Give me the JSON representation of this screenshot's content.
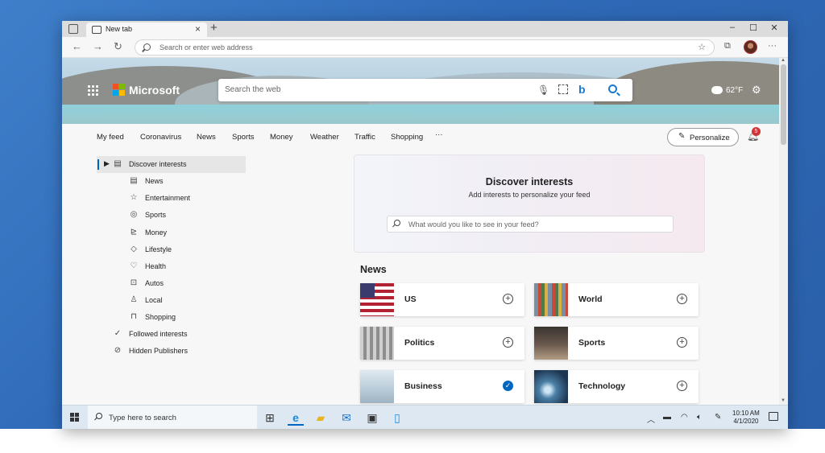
{
  "browser": {
    "tab_title": "New tab",
    "tab_close": "×",
    "new_tab": "+",
    "controls": {
      "minimize": "–",
      "maximize": "☐",
      "close": "✕"
    },
    "back": "←",
    "forward": "→",
    "reload": "↻",
    "address_placeholder": "Search or enter web address",
    "more": "···"
  },
  "hero": {
    "brand": "Microsoft",
    "search_placeholder": "Search the web",
    "bing": "b",
    "weather_temp": "62°F"
  },
  "feed_nav": {
    "items": [
      "My feed",
      "Coronavirus",
      "News",
      "Sports",
      "Money",
      "Weather",
      "Traffic",
      "Shopping",
      "···"
    ],
    "personalize": "Personalize",
    "notification_count": "5"
  },
  "sidebar": {
    "items": [
      {
        "label": "Discover interests",
        "icon": "newspaper-icon",
        "glyph": "▤"
      },
      {
        "label": "News",
        "icon": "news-icon",
        "glyph": "▤"
      },
      {
        "label": "Entertainment",
        "icon": "star-icon",
        "glyph": "☆"
      },
      {
        "label": "Sports",
        "icon": "ball-icon",
        "glyph": "◎"
      },
      {
        "label": "Money",
        "icon": "chart-icon",
        "glyph": "⊵"
      },
      {
        "label": "Lifestyle",
        "icon": "gem-icon",
        "glyph": "◇"
      },
      {
        "label": "Health",
        "icon": "heart-icon",
        "glyph": "♡"
      },
      {
        "label": "Autos",
        "icon": "car-icon",
        "glyph": "⊡"
      },
      {
        "label": "Local",
        "icon": "person-icon",
        "glyph": "♙"
      },
      {
        "label": "Shopping",
        "icon": "bag-icon",
        "glyph": "⊓"
      },
      {
        "label": "Followed interests",
        "icon": "check-circle-icon",
        "glyph": "✓"
      },
      {
        "label": "Hidden Publishers",
        "icon": "block-icon",
        "glyph": "⊘"
      }
    ]
  },
  "discover": {
    "title": "Discover interests",
    "subtitle": "Add interests to personalize your feed",
    "search_placeholder": "What would you like to see in your feed?"
  },
  "news": {
    "heading": "News",
    "topics": [
      {
        "label": "US",
        "followed": false
      },
      {
        "label": "World",
        "followed": false
      },
      {
        "label": "Politics",
        "followed": false
      },
      {
        "label": "Sports",
        "followed": false
      },
      {
        "label": "Business",
        "followed": true
      },
      {
        "label": "Technology",
        "followed": false
      }
    ],
    "add_glyph": "+",
    "check_glyph": "✓"
  },
  "taskbar": {
    "search_placeholder": "Type here to search",
    "time": "10:10 AM",
    "date": "4/1/2020"
  },
  "colors": {
    "accent": "#0067c0",
    "bing_blue": "#1976d2",
    "badge_red": "#d13438"
  }
}
